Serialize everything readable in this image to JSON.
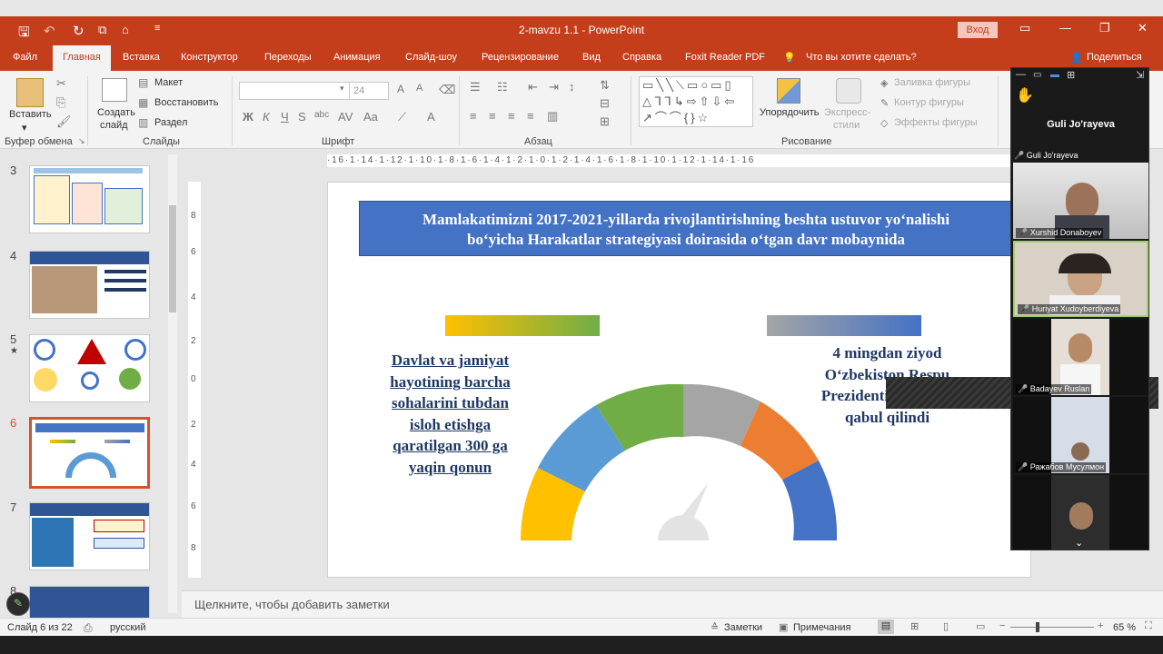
{
  "window": {
    "title": "2-mavzu 1.1  -  PowerPoint",
    "login": "Вход"
  },
  "tabs": [
    "Файл",
    "Главная",
    "Вставка",
    "Конструктор",
    "Переходы",
    "Анимация",
    "Слайд-шоу",
    "Рецензирование",
    "Вид",
    "Справка",
    "Foxit Reader PDF"
  ],
  "tell_me": "Что вы хотите сделать?",
  "share": "Поделиться",
  "ribbon": {
    "clipboard": {
      "paste": "Вставить",
      "label": "Буфер обмена"
    },
    "slides": {
      "new_slide_1": "Создать",
      "new_slide_2": "слайд",
      "layout": "Макет",
      "reset": "Восстановить",
      "section": "Раздел",
      "label": "Слайды"
    },
    "font": {
      "size": "24",
      "bold": "Ж",
      "italic": "К",
      "underline": "Ч",
      "strike": "S",
      "label": "Шрифт"
    },
    "paragraph": {
      "label": "Абзац"
    },
    "drawing": {
      "arrange": "Упорядочить",
      "quick_styles_1": "Экспресс-",
      "quick_styles_2": "стили",
      "fill": "Заливка фигуры",
      "outline": "Контур фигуры",
      "effects": "Эффекты фигуры",
      "label": "Рисование"
    }
  },
  "thumbnails": [
    {
      "num": "3"
    },
    {
      "num": "4"
    },
    {
      "num": "5",
      "star": "★"
    },
    {
      "num": "6"
    },
    {
      "num": "7"
    },
    {
      "num": "8"
    }
  ],
  "ruler": {
    "h": "·16·1·14·1·12·1·10·1·8·1·6·1·4·1·2·1·0·1·2·1·4·1·6·1·8·1·10·1·12·1·14·1·16",
    "v": [
      "8",
      "6",
      "4",
      "2",
      "0",
      "2",
      "4",
      "6",
      "8"
    ]
  },
  "slide": {
    "title_line1": "Mamlakatimizni 2017-2021-yillarda rivojlantirishning beshta ustuvor yo‘nalishi",
    "title_line2": "bo‘yicha Harakatlar strategiyasi doirasida o‘tgan davr mobaynida",
    "left_text": "Davlat va jamiyat hayotining barcha sohalarini tubdan isloh etishga qaratilgan 300 ga yaqin qonun",
    "right_text": "4 mingdan ziyod O‘zbekiston Respu Prezidenti qarorlari qabul qilindi"
  },
  "notes": "Щелкните, чтобы добавить заметки",
  "status": {
    "slide": "Слайд 6 из 22",
    "lang": "русский",
    "notes": "Заметки",
    "comments": "Примечания",
    "zoom": "65 %"
  },
  "video": {
    "host": "Guli Jo'rayeva",
    "participants": [
      "Guli Jo'rayeva",
      "Xurshid Donaboyev",
      "Huriyat Xudoyberdiyeva",
      "Badayev Ruslan",
      "Ражабов Мусулмон",
      ""
    ]
  },
  "colors": {
    "accent": "#c43e1c",
    "slide_title_bg": "#4472c4",
    "slide_text": "#1f3864"
  }
}
